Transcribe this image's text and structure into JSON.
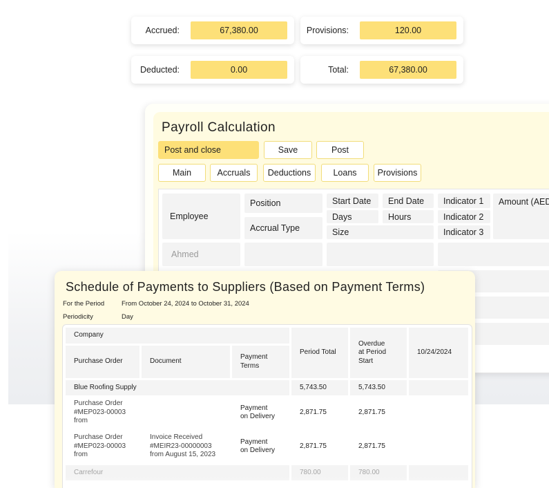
{
  "summary": {
    "accrued": {
      "label": "Accrued:",
      "value": "67,380.00"
    },
    "provisions": {
      "label": "Provisions:",
      "value": "120.00"
    },
    "deducted": {
      "label": "Deducted:",
      "value": "0.00"
    },
    "total": {
      "label": "Total:",
      "value": "67,380.00"
    }
  },
  "payroll": {
    "title": "Payroll Calculation",
    "actions": {
      "post_close": "Post and close",
      "save": "Save",
      "post": "Post"
    },
    "tabs": [
      "Main",
      "Accruals",
      "Deductions",
      "Loans",
      "Provisions"
    ],
    "columns": {
      "employee": "Employee",
      "position": "Position",
      "accrual_type": "Accrual Type",
      "start_date": "Start Date",
      "end_date": "End Date",
      "days": "Days",
      "hours": "Hours",
      "size": "Size",
      "indicator1": "Indicator 1",
      "indicator2": "Indicator 2",
      "indicator3": "Indicator 3",
      "amount": "Amount (AED)"
    },
    "rows": [
      {
        "employee": "Ahmed"
      }
    ]
  },
  "schedule": {
    "title": "Schedule of Payments to Suppliers (Based on Payment Terms)",
    "meta": {
      "period_label": "For the Period",
      "period_value": "From October 24, 2024 to October 31, 2024",
      "periodicity_label": "Periodicity",
      "periodicity_value": "Day"
    },
    "headers": {
      "company": "Company",
      "purchase_order": "Purchase Order",
      "document": "Document",
      "payment_terms": "Payment Terms",
      "period_total": "Period Total",
      "overdue": "Overdue at Period Start",
      "date_col": "10/24/2024"
    },
    "rows": [
      {
        "name": "Blue Roofing Supply",
        "period_total": "5,743.50",
        "overdue": "5,743.50"
      },
      {
        "po": "Purchase Order #MEP023-00003 from",
        "document": "",
        "terms": "Payment on Delivery",
        "period_total": "2,871.75",
        "overdue": "2,871.75"
      },
      {
        "po": "Purchase Order #MEP023-00003 from",
        "document": "Invoice Received #MEIR23-00000003 from August 15, 2023",
        "terms": "Payment on Delivery",
        "period_total": "2,871.75",
        "overdue": "2,871.75"
      },
      {
        "name": "Carrefour",
        "period_total": "780.00",
        "overdue": "780.00"
      }
    ]
  },
  "colors": {
    "accent_yellow": "#fde078",
    "panel_cream": "#fffbe0",
    "cell_grey": "#f3f3f3"
  }
}
